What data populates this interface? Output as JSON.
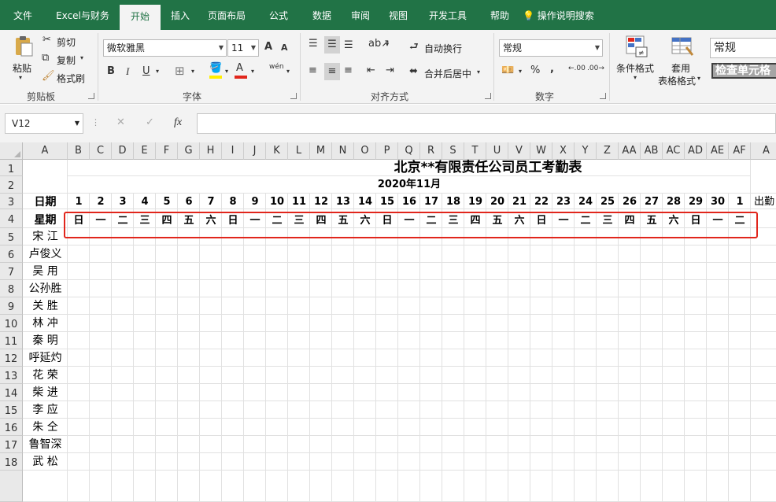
{
  "tabs": [
    "文件",
    "Excel与财务",
    "开始",
    "插入",
    "页面布局",
    "公式",
    "数据",
    "审阅",
    "视图",
    "开发工具",
    "帮助",
    "操作说明搜索"
  ],
  "active_tab": "开始",
  "ribbon": {
    "clipboard": {
      "paste": "粘贴",
      "cut": "剪切",
      "copy": "复制",
      "format_painter": "格式刷",
      "label": "剪贴板"
    },
    "font": {
      "name": "微软雅黑",
      "size": "11",
      "bold": "B",
      "italic": "I",
      "underline": "U",
      "grow": "A",
      "shrink": "A",
      "label": "字体",
      "wen": "wén"
    },
    "alignment": {
      "wrap": "自动换行",
      "merge": "合并后居中",
      "label": "对齐方式"
    },
    "number": {
      "format": "常规",
      "percent": "%",
      "comma": ",",
      "label": "数字",
      "inc_dec": ".00",
      "dec_dec": ".00"
    },
    "styles": {
      "conditional": "条件格式",
      "table_format_line1": "套用",
      "table_format_line2": "表格格式",
      "normal": "常规",
      "check_cell": "检查单元格"
    }
  },
  "formula_bar": {
    "name_box": "V12",
    "cancel": "✕",
    "enter": "✓",
    "fx": "fx",
    "value": ""
  },
  "columns": [
    "A",
    "B",
    "C",
    "D",
    "E",
    "F",
    "G",
    "H",
    "I",
    "J",
    "K",
    "L",
    "M",
    "N",
    "O",
    "P",
    "Q",
    "R",
    "S",
    "T",
    "U",
    "V",
    "W",
    "X",
    "Y",
    "Z",
    "AA",
    "AB",
    "AC",
    "AD",
    "AE",
    "AF",
    "A"
  ],
  "rows": [
    "1",
    "2",
    "3",
    "4",
    "5",
    "6",
    "7",
    "8",
    "9",
    "10",
    "11",
    "12",
    "13",
    "14",
    "15",
    "16",
    "17",
    "18",
    ""
  ],
  "sheet": {
    "title": "北京**有限责任公司员工考勤表",
    "month": "2020年11月",
    "date_label": "日期",
    "weekday_label": "星期",
    "days": [
      "1",
      "2",
      "3",
      "4",
      "5",
      "6",
      "7",
      "8",
      "9",
      "10",
      "11",
      "12",
      "13",
      "14",
      "15",
      "16",
      "17",
      "18",
      "19",
      "20",
      "21",
      "22",
      "23",
      "24",
      "25",
      "26",
      "27",
      "28",
      "29",
      "30",
      "1"
    ],
    "weekdays": [
      "日",
      "一",
      "二",
      "三",
      "四",
      "五",
      "六",
      "日",
      "一",
      "二",
      "三",
      "四",
      "五",
      "六",
      "日",
      "一",
      "二",
      "三",
      "四",
      "五",
      "六",
      "日",
      "一",
      "二",
      "三",
      "四",
      "五",
      "六",
      "日",
      "一",
      "二"
    ],
    "attendance_label": "出勤",
    "employees": [
      "宋 江",
      "卢俊义",
      "吴 用",
      "公孙胜",
      "关 胜",
      "林 冲",
      "秦 明",
      "呼延灼",
      "花 荣",
      "柴 进",
      "李 应",
      "朱 仝",
      "鲁智深",
      "武 松"
    ]
  },
  "colors": {
    "excel_green": "#217346",
    "highlight": "#e1261c",
    "font_color_bar": "#e1261c",
    "fill_color_bar": "#ffee00"
  }
}
